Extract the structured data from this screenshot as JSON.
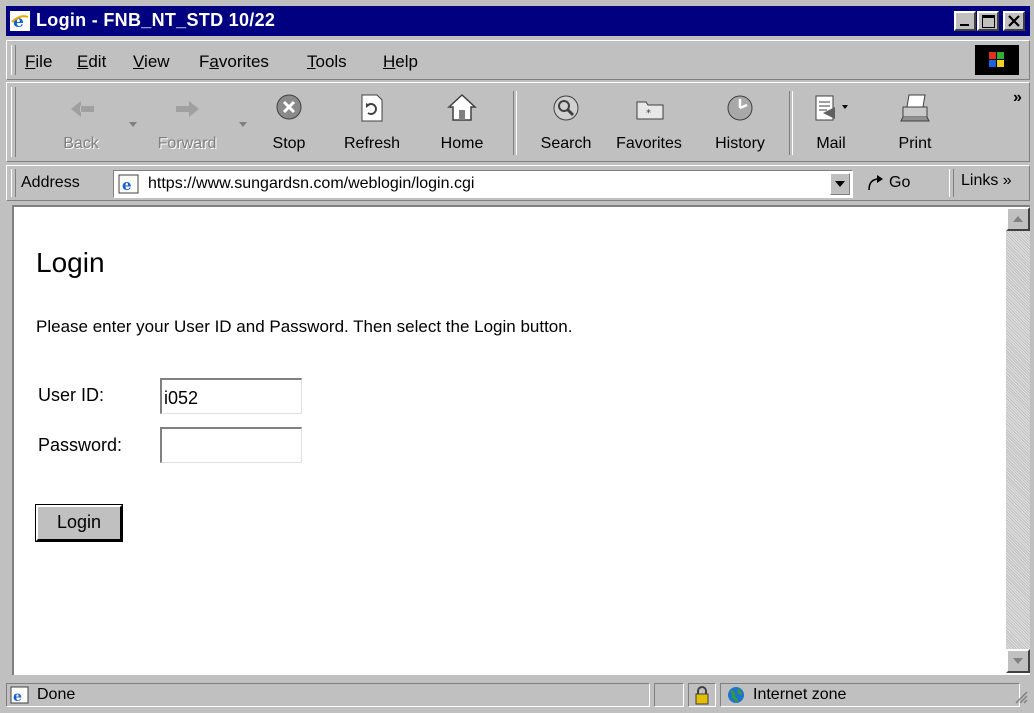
{
  "window": {
    "title": "Login - FNB_NT_STD 10/22"
  },
  "menu": [
    {
      "label": "File",
      "key": "F",
      "rest": "ile"
    },
    {
      "label": "Edit",
      "key": "E",
      "rest": "dit"
    },
    {
      "label": "View",
      "key": "V",
      "rest": "iew"
    },
    {
      "label": "Favorites",
      "pre": "F",
      "key": "a",
      "rest": "vorites"
    },
    {
      "label": "Tools",
      "key": "T",
      "rest": "ools"
    },
    {
      "label": "Help",
      "key": "H",
      "rest": "elp"
    }
  ],
  "toolbar": {
    "back": "Back",
    "forward": "Forward",
    "stop": "Stop",
    "refresh": "Refresh",
    "home": "Home",
    "search": "Search",
    "favorites": "Favorites",
    "history": "History",
    "mail": "Mail",
    "print": "Print",
    "more": "»"
  },
  "address": {
    "label": "Address",
    "url": "https://www.sungardsn.com/weblogin/login.cgi",
    "go": "Go",
    "links": "Links »"
  },
  "page": {
    "heading": "Login",
    "instructions": "Please enter your User ID and Password. Then select the Login button.",
    "user_id_label": "User ID:",
    "user_id_value": "i052",
    "password_label": "Password:",
    "password_value": "",
    "login_button": "Login"
  },
  "status": {
    "text": "Done",
    "zone": "Internet zone"
  },
  "colors": {
    "title_bg": "#000080",
    "chrome": "#c0c0c0"
  }
}
